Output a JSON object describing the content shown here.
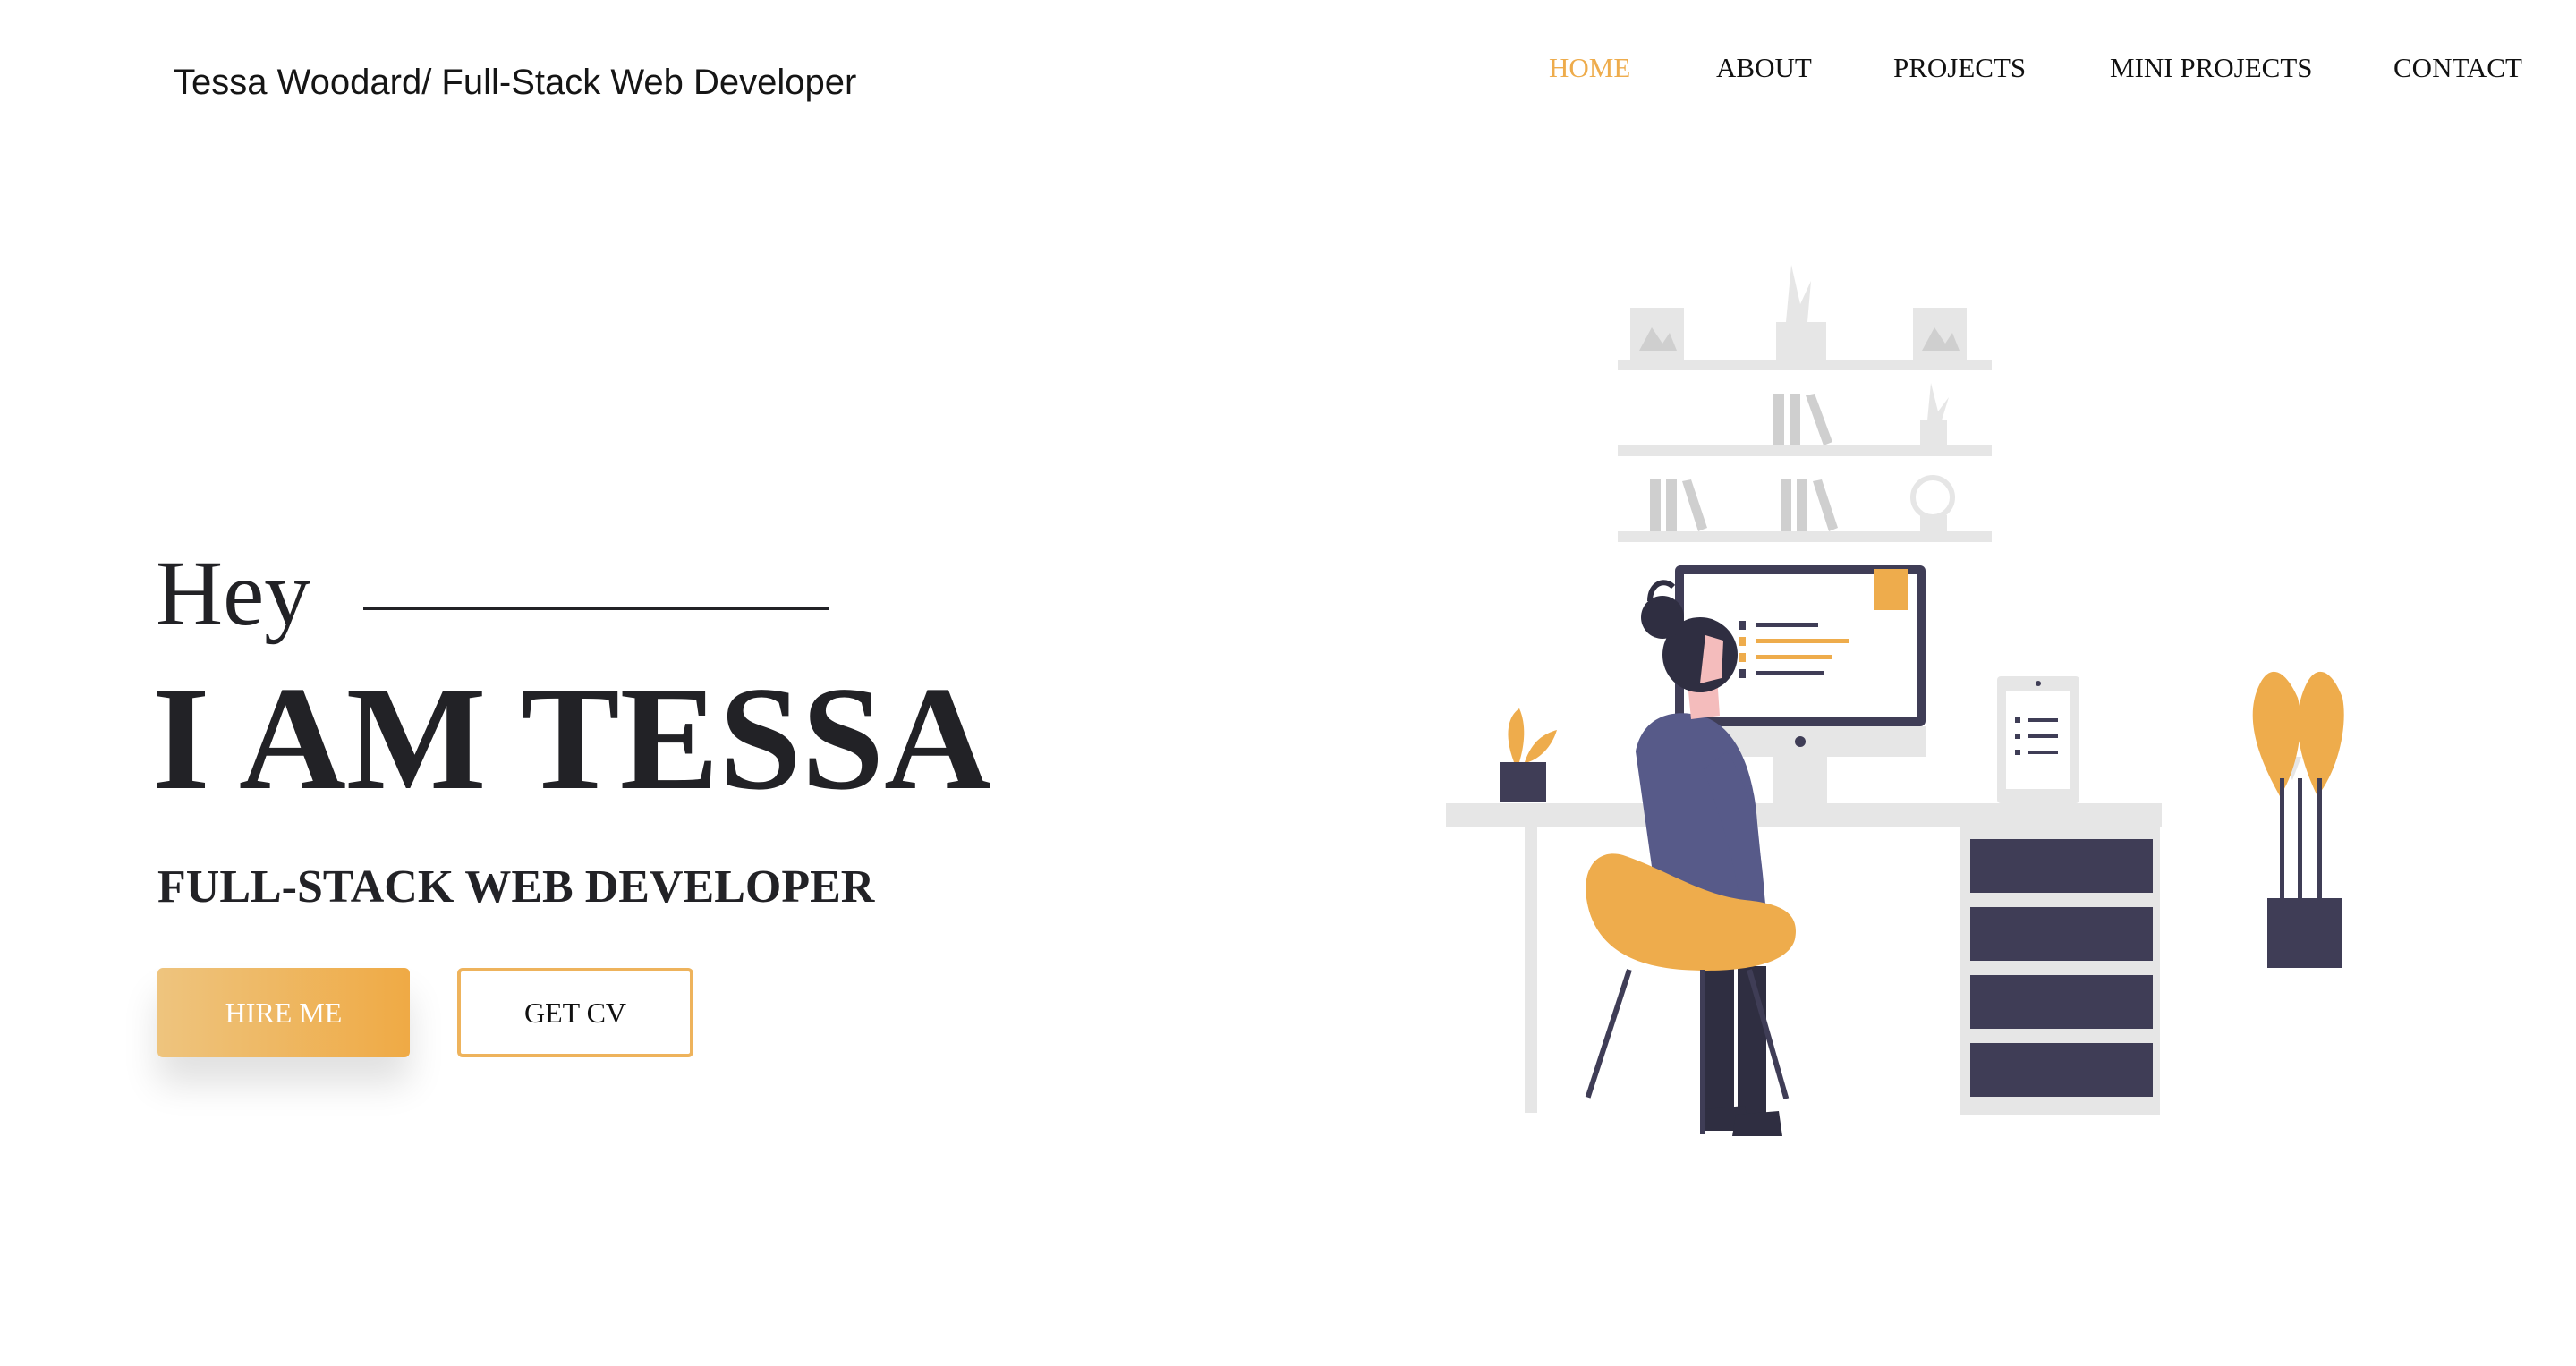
{
  "header": {
    "brand": "Tessa Woodard/ Full-Stack Web Developer",
    "nav": [
      {
        "label": "HOME",
        "active": true
      },
      {
        "label": "ABOUT",
        "active": false
      },
      {
        "label": "PROJECTS",
        "active": false
      },
      {
        "label": "MINI PROJECTS",
        "active": false
      },
      {
        "label": "CONTACT",
        "active": false
      }
    ]
  },
  "hero": {
    "greeting": "Hey",
    "headline": "I AM TESSA",
    "subtitle": "FULL-STACK WEB DEVELOPER",
    "hire_label": "HIRE ME",
    "cv_label": "GET CV",
    "illustration": "woman-at-desk-illustration"
  },
  "colors": {
    "accent": "#eeac4c",
    "text": "#222226",
    "purple": "#3f3d56",
    "light_gray": "#e6e6e6"
  }
}
